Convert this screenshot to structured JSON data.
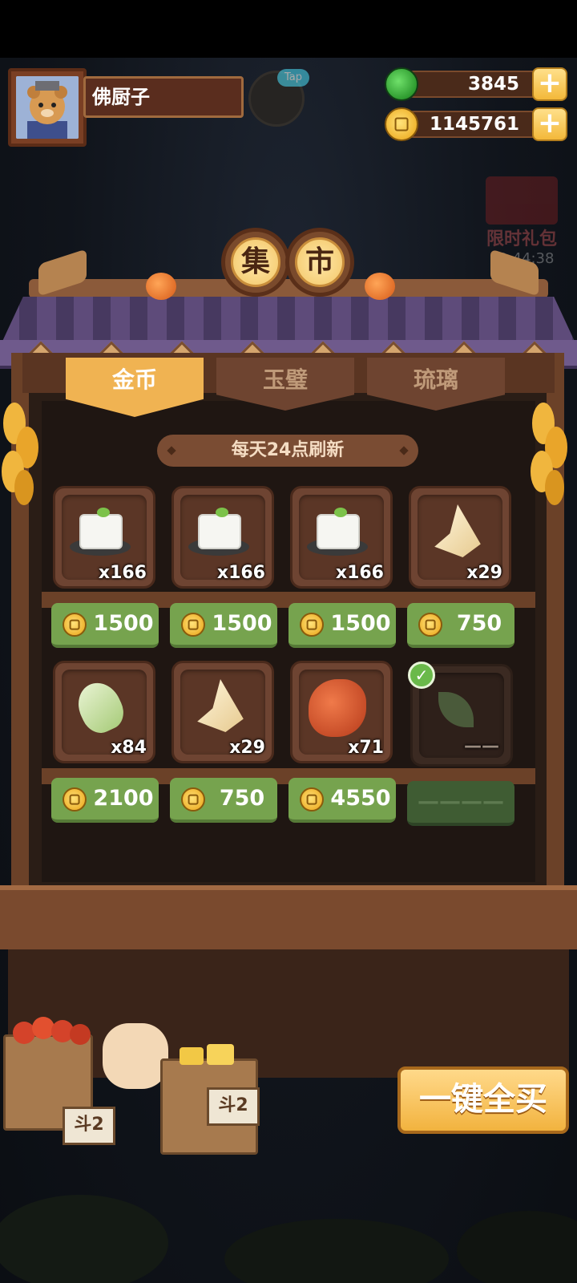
{
  "player": {
    "name": "佛厨子"
  },
  "helper": {
    "tag": "Tap"
  },
  "currencies": {
    "jade": {
      "value": "3845",
      "icon": "jade-icon"
    },
    "coin": {
      "value": "1145761",
      "icon": "coin-icon"
    }
  },
  "event": {
    "label": "限时礼包",
    "timer": "12:44:38"
  },
  "shop": {
    "title": [
      "集",
      "市"
    ],
    "tabs": [
      {
        "label": "金币",
        "active": true
      },
      {
        "label": "玉璧",
        "active": false
      },
      {
        "label": "琉璃",
        "active": false
      }
    ],
    "refresh_note": "每天24点刷新",
    "items": [
      {
        "art": "tofu",
        "qty": "x166",
        "price": "1500"
      },
      {
        "art": "tofu",
        "qty": "x166",
        "price": "1500"
      },
      {
        "art": "tofu",
        "qty": "x166",
        "price": "1500"
      },
      {
        "art": "bamboo-slice",
        "qty": "x29",
        "price": "750"
      },
      {
        "art": "bamboo-shoot",
        "qty": "x84",
        "price": "2100"
      },
      {
        "art": "bamboo-slice",
        "qty": "x29",
        "price": "750"
      },
      {
        "art": "fish",
        "qty": "x71",
        "price": "4550"
      },
      {
        "art": "tea-leaf",
        "qty": "——",
        "price": "————",
        "sold": true
      }
    ],
    "buy_all": "一键全买"
  },
  "stall_signs": [
    "斗2",
    "斗2"
  ],
  "colors": {
    "price_green": "#76a34e",
    "tab_active": "#f0b352",
    "wood": "#6b4128"
  }
}
